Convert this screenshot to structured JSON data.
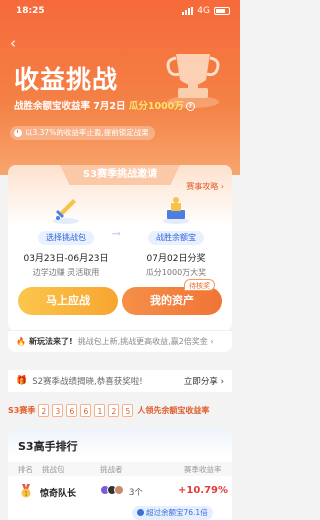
{
  "status_bar": {
    "time": "18:25",
    "network": "4G"
  },
  "header": {
    "title": "收益挑战",
    "slogan_prefix": "战胜余额宝收益率 7月2日 ",
    "slogan_highlight": "瓜分1000万",
    "note": "以3.37%的收益率止盈,提前锁定战果"
  },
  "invite_card": {
    "title": "S3赛季挑战邀请",
    "strategy_link": "赛事攻略 ›",
    "steps": [
      {
        "label": "选择挑战包",
        "date": "03月23日-06月23日",
        "desc": "边学边赚 灵活取用"
      },
      {
        "label": "战胜余额宝",
        "date": "07月02日分奖",
        "desc": "瓜分1000万大奖"
      }
    ],
    "pending_badge": "待核奖",
    "primary_button": "马上应战",
    "secondary_button": "我的资产"
  },
  "ticker": {
    "tag": "新玩法来了!",
    "message": "挑战包上新,挑战更高收益,赢2倍奖金 ›"
  },
  "share_bar": {
    "text": "S2赛季战绩揭晓,恭喜获奖啦!",
    "action": "立即分享 ›"
  },
  "season_bar": {
    "label": "S3赛季",
    "digits": [
      "2",
      "3",
      "6",
      "6",
      "1",
      "2",
      "5"
    ],
    "tail": "人领先余额宝收益率"
  },
  "ranking": {
    "title": "S3高手排行",
    "columns": [
      "排名",
      "挑战包",
      "挑战者",
      "赛季收益率"
    ],
    "rows": [
      {
        "team": "惊奇队长",
        "challengers": "3个",
        "rate": "+10.79%"
      }
    ],
    "exceed_badge": "超过余额宝76.1倍"
  },
  "colors": {
    "accent": "#f7693a",
    "gold": "#ffe56a",
    "positive": "#e33b3b"
  }
}
